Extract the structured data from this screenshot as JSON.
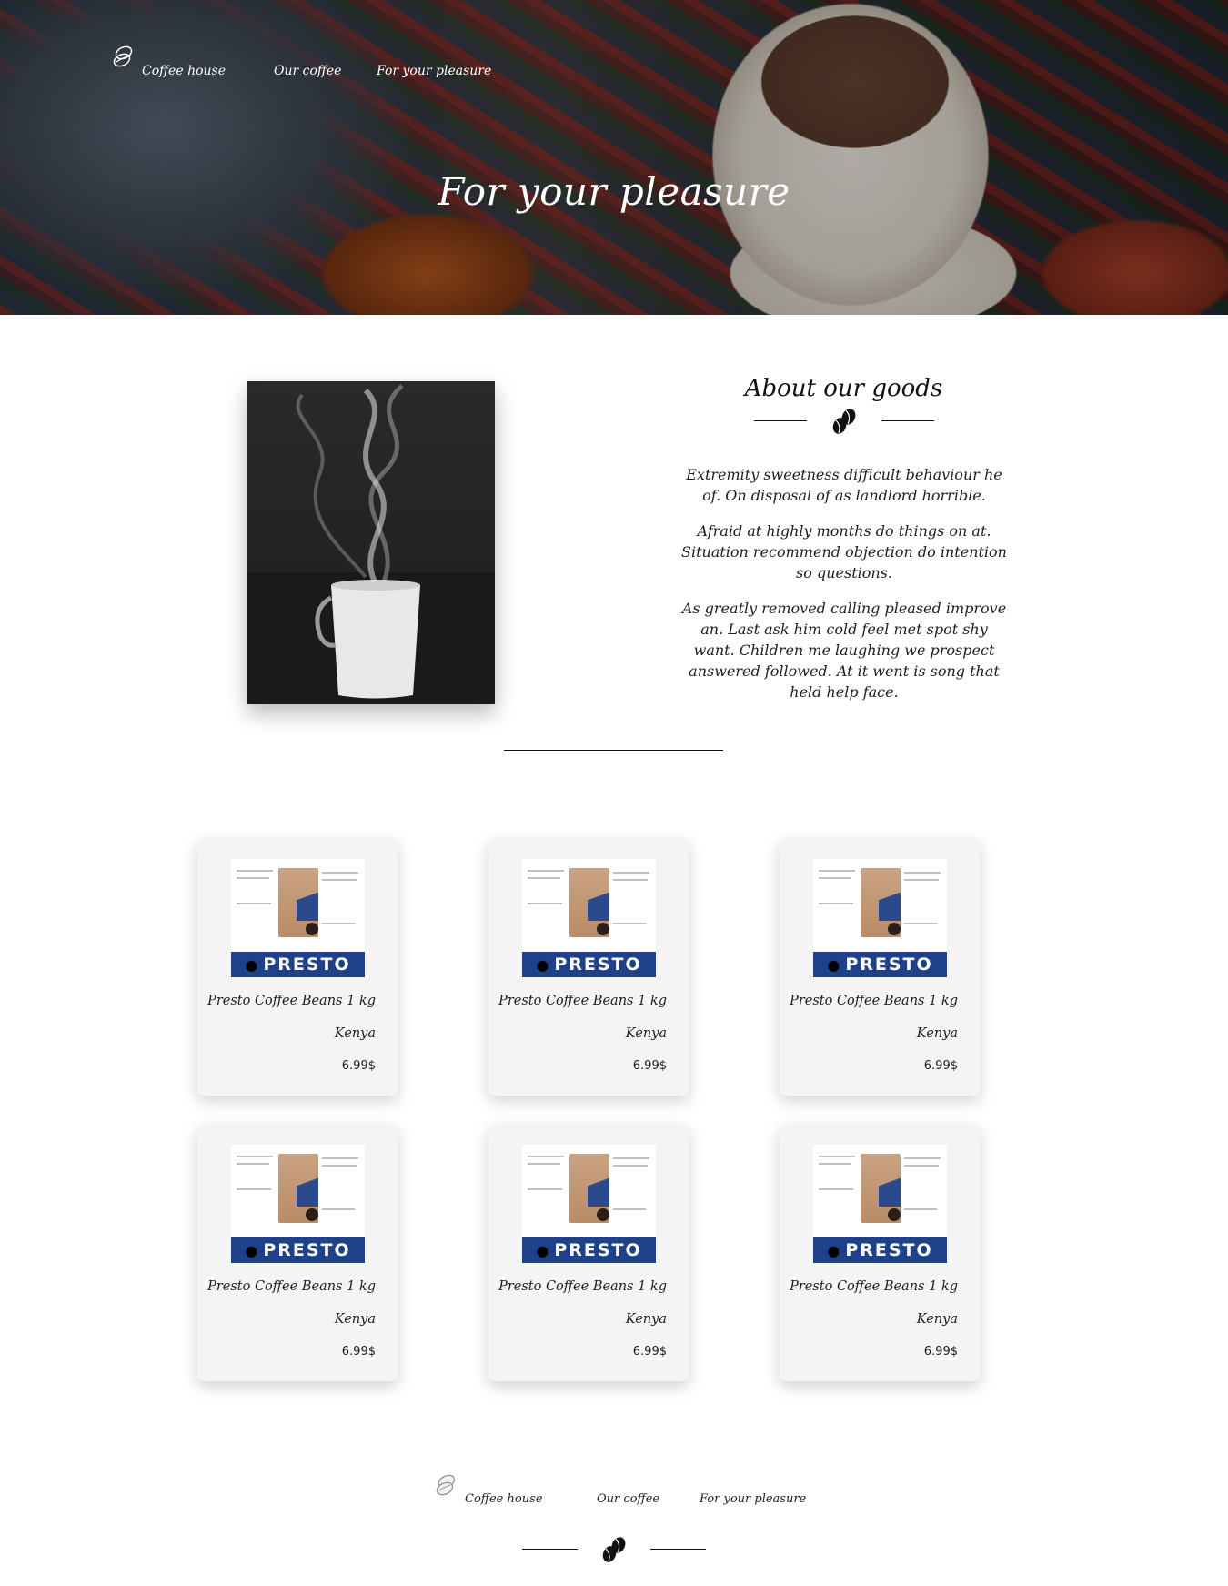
{
  "header": {
    "nav": [
      {
        "label": "Coffee house",
        "icon": "coffee-beans-logo-icon"
      },
      {
        "label": "Our coffee"
      },
      {
        "label": "For your pleasure"
      }
    ],
    "title": "For your pleasure"
  },
  "about": {
    "title": "About our goods",
    "divider_icon": "coffee-beans-icon",
    "paragraphs": [
      "Extremity sweetness difficult behaviour he of. On disposal of as landlord horrible.",
      "Afraid at highly months do things on at. Situation recommend objection do intention so questions.",
      "As greatly removed calling pleased improve an. Last ask him cold feel met spot shy want. Children me laughing we prospect answered followed. At it went is song that held help face."
    ]
  },
  "products": [
    {
      "brand": "PRESTO",
      "name": "Presto Coffee Beans 1 kg",
      "origin": "Kenya",
      "price": "6.99$"
    },
    {
      "brand": "PRESTO",
      "name": "Presto Coffee Beans 1 kg",
      "origin": "Kenya",
      "price": "6.99$"
    },
    {
      "brand": "PRESTO",
      "name": "Presto Coffee Beans 1 kg",
      "origin": "Kenya",
      "price": "6.99$"
    },
    {
      "brand": "PRESTO",
      "name": "Presto Coffee Beans 1 kg",
      "origin": "Kenya",
      "price": "6.99$"
    },
    {
      "brand": "PRESTO",
      "name": "Presto Coffee Beans 1 kg",
      "origin": "Kenya",
      "price": "6.99$"
    },
    {
      "brand": "PRESTO",
      "name": "Presto Coffee Beans 1 kg",
      "origin": "Kenya",
      "price": "6.99$"
    }
  ],
  "footer": {
    "nav": [
      {
        "label": "Coffee house",
        "icon": "coffee-beans-logo-icon"
      },
      {
        "label": "Our coffee"
      },
      {
        "label": "For your pleasure"
      }
    ],
    "divider_icon": "coffee-beans-icon"
  }
}
